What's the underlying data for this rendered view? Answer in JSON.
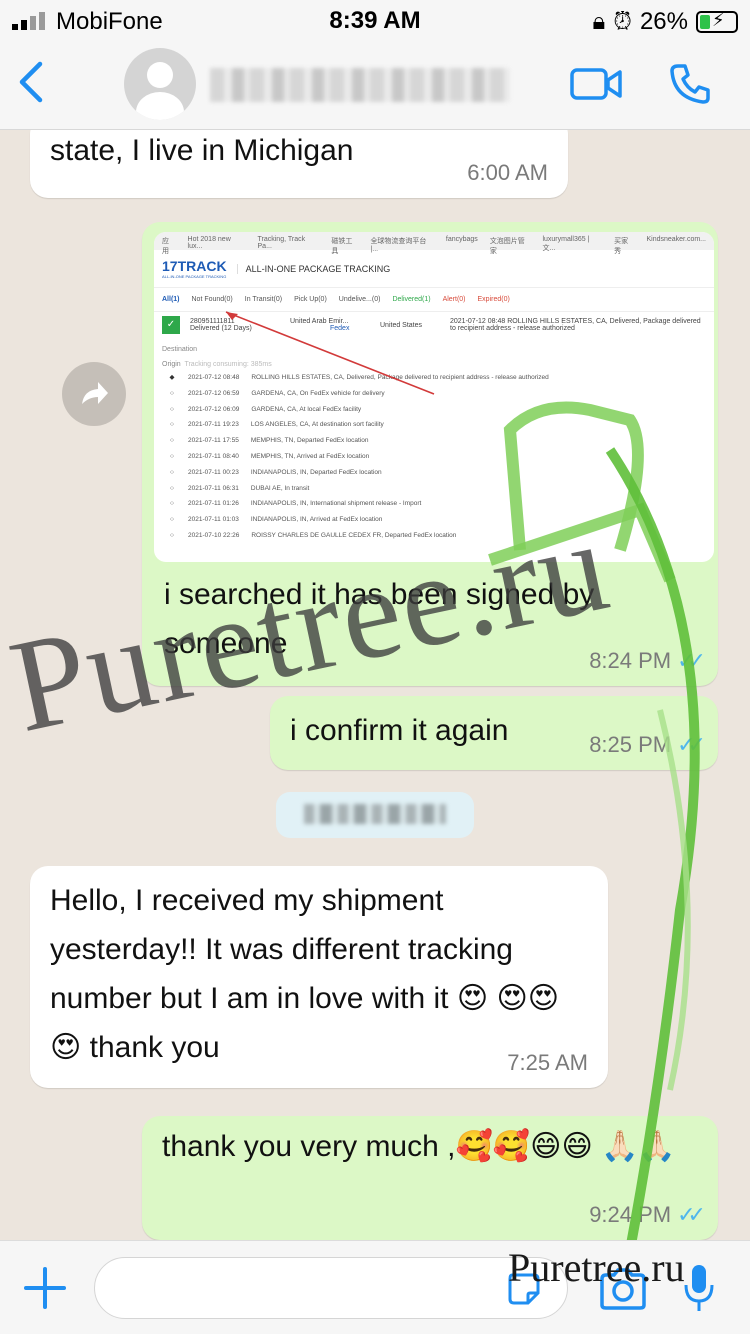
{
  "status_bar": {
    "carrier": "MobiFone",
    "time": "8:39 AM",
    "battery": "26%"
  },
  "header": {
    "contact_name": ""
  },
  "messages": [
    {
      "direction": "in",
      "text": "state, I live in Michigan",
      "time": "6:00 AM"
    },
    {
      "direction": "out",
      "text": "i searched it has been signed by someone",
      "time": "8:24 PM"
    },
    {
      "direction": "out",
      "text": "i confirm it again",
      "time": "8:25 PM"
    },
    {
      "direction": "in",
      "text": "Hello, I received my shipment yesterday!! It was different tracking number but I am in love with it 😍 😍😍😍 thank you",
      "time": "7:25 AM"
    },
    {
      "direction": "out",
      "text": "thank you very much ,🥰🥰😄😄 🙏🏻🙏🏻",
      "time": "9:24 PM"
    }
  ],
  "screenshot": {
    "bookmarks": [
      "应用",
      "Hot 2018 new lux...",
      "Tracking, Track Pa...",
      "磁铁工具",
      "全球物流查询平台 |...",
      "fancybags",
      "文泡图片管家",
      "luxurymall365 | 文...",
      "买家秀",
      "Kindsneaker.com..."
    ],
    "brand": "17TRACK",
    "brand_sub": "ALL-IN-ONE PACKAGE TRACKING",
    "heading": "ALL-IN-ONE PACKAGE TRACKING",
    "tabs": [
      "All(1)",
      "Not Found(0)",
      "In Transit(0)",
      "Pick Up(0)",
      "Undelive...(0)",
      "Delivered(1)",
      "Alert(0)",
      "Expired(0)"
    ],
    "tracking_number": "280951111811",
    "status": "Delivered (12 Days)",
    "from": "United Arab Emir...",
    "carrier": "Fedex",
    "to": "United States",
    "latest": "2021-07-12 08:48  ROLLING HILLS ESTATES, CA, Delivered, Package delivered to recipient address - release authorized",
    "destination_label": "Destination",
    "origin_label": "Origin",
    "origin_note": "Tracking consuming: 385ms",
    "events": [
      {
        "time": "2021-07-12 08:48",
        "text": "ROLLING HILLS ESTATES, CA, Delivered, Package delivered to recipient address - release authorized"
      },
      {
        "time": "2021-07-12 06:59",
        "text": "GARDENA, CA, On FedEx vehicle for delivery"
      },
      {
        "time": "2021-07-12 06:09",
        "text": "GARDENA, CA, At local FedEx facility"
      },
      {
        "time": "2021-07-11 19:23",
        "text": "LOS ANGELES, CA, At destination sort facility"
      },
      {
        "time": "2021-07-11 17:55",
        "text": "MEMPHIS, TN, Departed FedEx location"
      },
      {
        "time": "2021-07-11 08:40",
        "text": "MEMPHIS, TN, Arrived at FedEx location"
      },
      {
        "time": "2021-07-11 00:23",
        "text": "INDIANAPOLIS, IN, Departed FedEx location"
      },
      {
        "time": "2021-07-11 06:31",
        "text": "DUBAI AE, In transit"
      },
      {
        "time": "2021-07-11 01:26",
        "text": "INDIANAPOLIS, IN, International shipment release - Import"
      },
      {
        "time": "2021-07-11 01:03",
        "text": "INDIANAPOLIS, IN, Arrived at FedEx location"
      },
      {
        "time": "2021-07-10 22:26",
        "text": "ROISSY CHARLES DE GAULLE CEDEX FR, Departed FedEx location"
      }
    ]
  },
  "date_chip": "",
  "watermark": {
    "big": "Puretree.ru",
    "small": "Puretree.ru"
  },
  "input": {
    "placeholder": ""
  },
  "colors": {
    "accent": "#1f8ef1",
    "outgoing_bubble": "#dcf8c6",
    "incoming_bubble": "#ffffff",
    "read_ticks": "#4fb6ec"
  }
}
